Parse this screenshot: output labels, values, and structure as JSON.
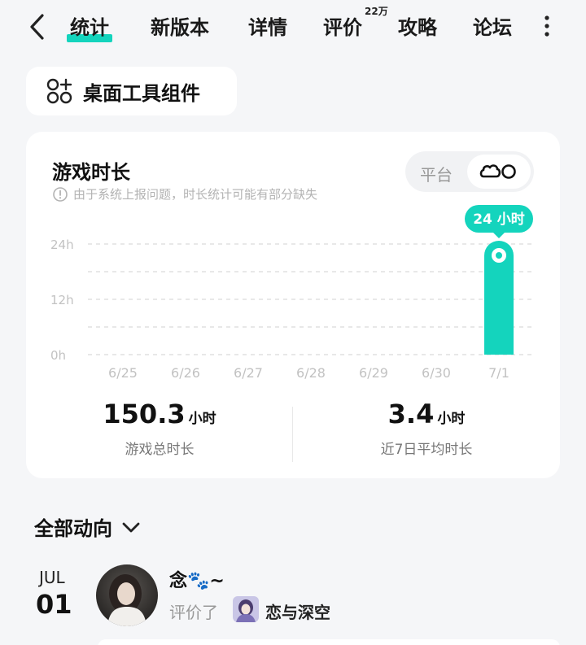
{
  "nav": {
    "tabs": [
      {
        "label": "统计",
        "active": true
      },
      {
        "label": "新版本"
      },
      {
        "label": "详情"
      },
      {
        "label": "评价"
      },
      {
        "label": "攻略"
      },
      {
        "label": "论坛"
      }
    ],
    "review_badge": "22万"
  },
  "widget_button": {
    "label": "桌面工具组件"
  },
  "playtime_card": {
    "title": "游戏时长",
    "note": "由于系统上报问题，时长统计可能有部分缺失",
    "toggle": {
      "platform_label": "平台",
      "active_icon": "cloud-game-icon"
    },
    "stats": [
      {
        "value": "150.3",
        "unit": "小时",
        "label": "游戏总时长"
      },
      {
        "value": "3.4",
        "unit": "小时",
        "label": "近7日平均时长"
      }
    ]
  },
  "chart_data": {
    "type": "bar",
    "categories": [
      "6/25",
      "6/26",
      "6/27",
      "6/28",
      "6/29",
      "6/30",
      "7/1"
    ],
    "values": [
      0,
      0,
      0,
      0,
      0,
      0,
      24
    ],
    "ylim": [
      0,
      24
    ],
    "yticks": [
      "0h",
      "12h",
      "24h"
    ],
    "highlight_label": "24 小时",
    "grid": true,
    "bar_color": "#14d4bd"
  },
  "activity": {
    "header": "全部动向",
    "items": [
      {
        "month": "JUL",
        "day": "01",
        "username": "念🐾~",
        "action": "评价了",
        "game": "恋与深空"
      }
    ]
  },
  "colors": {
    "accent": "#14d4bd",
    "background": "#f5f6f8"
  }
}
